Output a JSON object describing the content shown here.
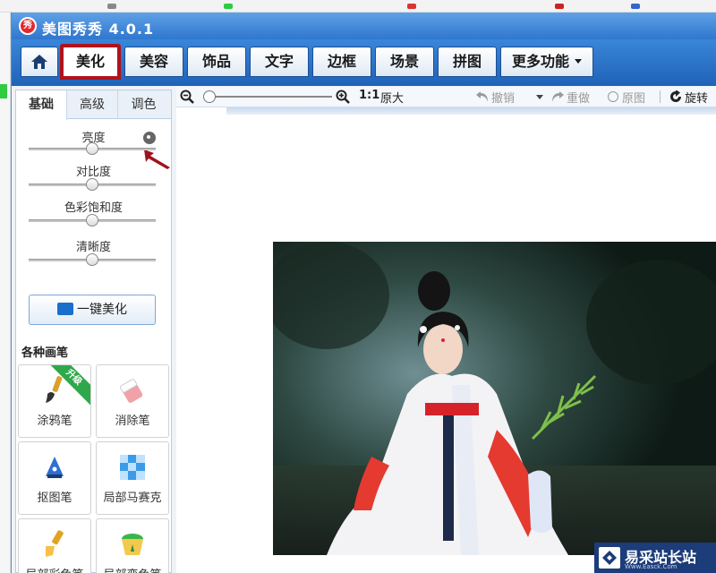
{
  "window": {
    "title": "美图秀秀 4.0.1",
    "logo_text": "秀"
  },
  "menu": {
    "tabs": [
      {
        "label": ""
      },
      {
        "label": "美化"
      },
      {
        "label": "美容"
      },
      {
        "label": "饰品"
      },
      {
        "label": "文字"
      },
      {
        "label": "边框"
      },
      {
        "label": "场景"
      },
      {
        "label": "拼图"
      },
      {
        "label": "更多功能"
      }
    ]
  },
  "panel": {
    "subtabs": [
      {
        "label": "基础"
      },
      {
        "label": "高级"
      },
      {
        "label": "调色"
      }
    ],
    "sliders": [
      {
        "label": "亮度",
        "value": 0.5
      },
      {
        "label": "对比度",
        "value": 0.5
      },
      {
        "label": "色彩饱和度",
        "value": 0.5
      },
      {
        "label": "清晰度",
        "value": 0.5
      }
    ],
    "one_key_label": "一键美化",
    "brush_section_title": "各种画笔",
    "brushes": [
      {
        "label": "涂鸦笔",
        "badge": "升级"
      },
      {
        "label": "消除笔"
      },
      {
        "label": "抠图笔"
      },
      {
        "label": "局部马赛克"
      },
      {
        "label": "局部彩色笔"
      },
      {
        "label": "局部变色笔"
      }
    ]
  },
  "toolbar": {
    "zoom_value": 0.0,
    "ratio_label": "1:1",
    "original_size": "原大",
    "undo": "撤销",
    "redo": "重做",
    "original": "原图",
    "rotate": "旋转"
  },
  "watermark": {
    "text": "易采站长站",
    "sub": "Www.Easck.Com"
  },
  "colors": {
    "title_bar": "#2f77cf",
    "menu_bar": "#1f63b8",
    "highlight": "#b0121b",
    "ribbon": "#2ea84a",
    "watermark": "#1c3c7a"
  }
}
